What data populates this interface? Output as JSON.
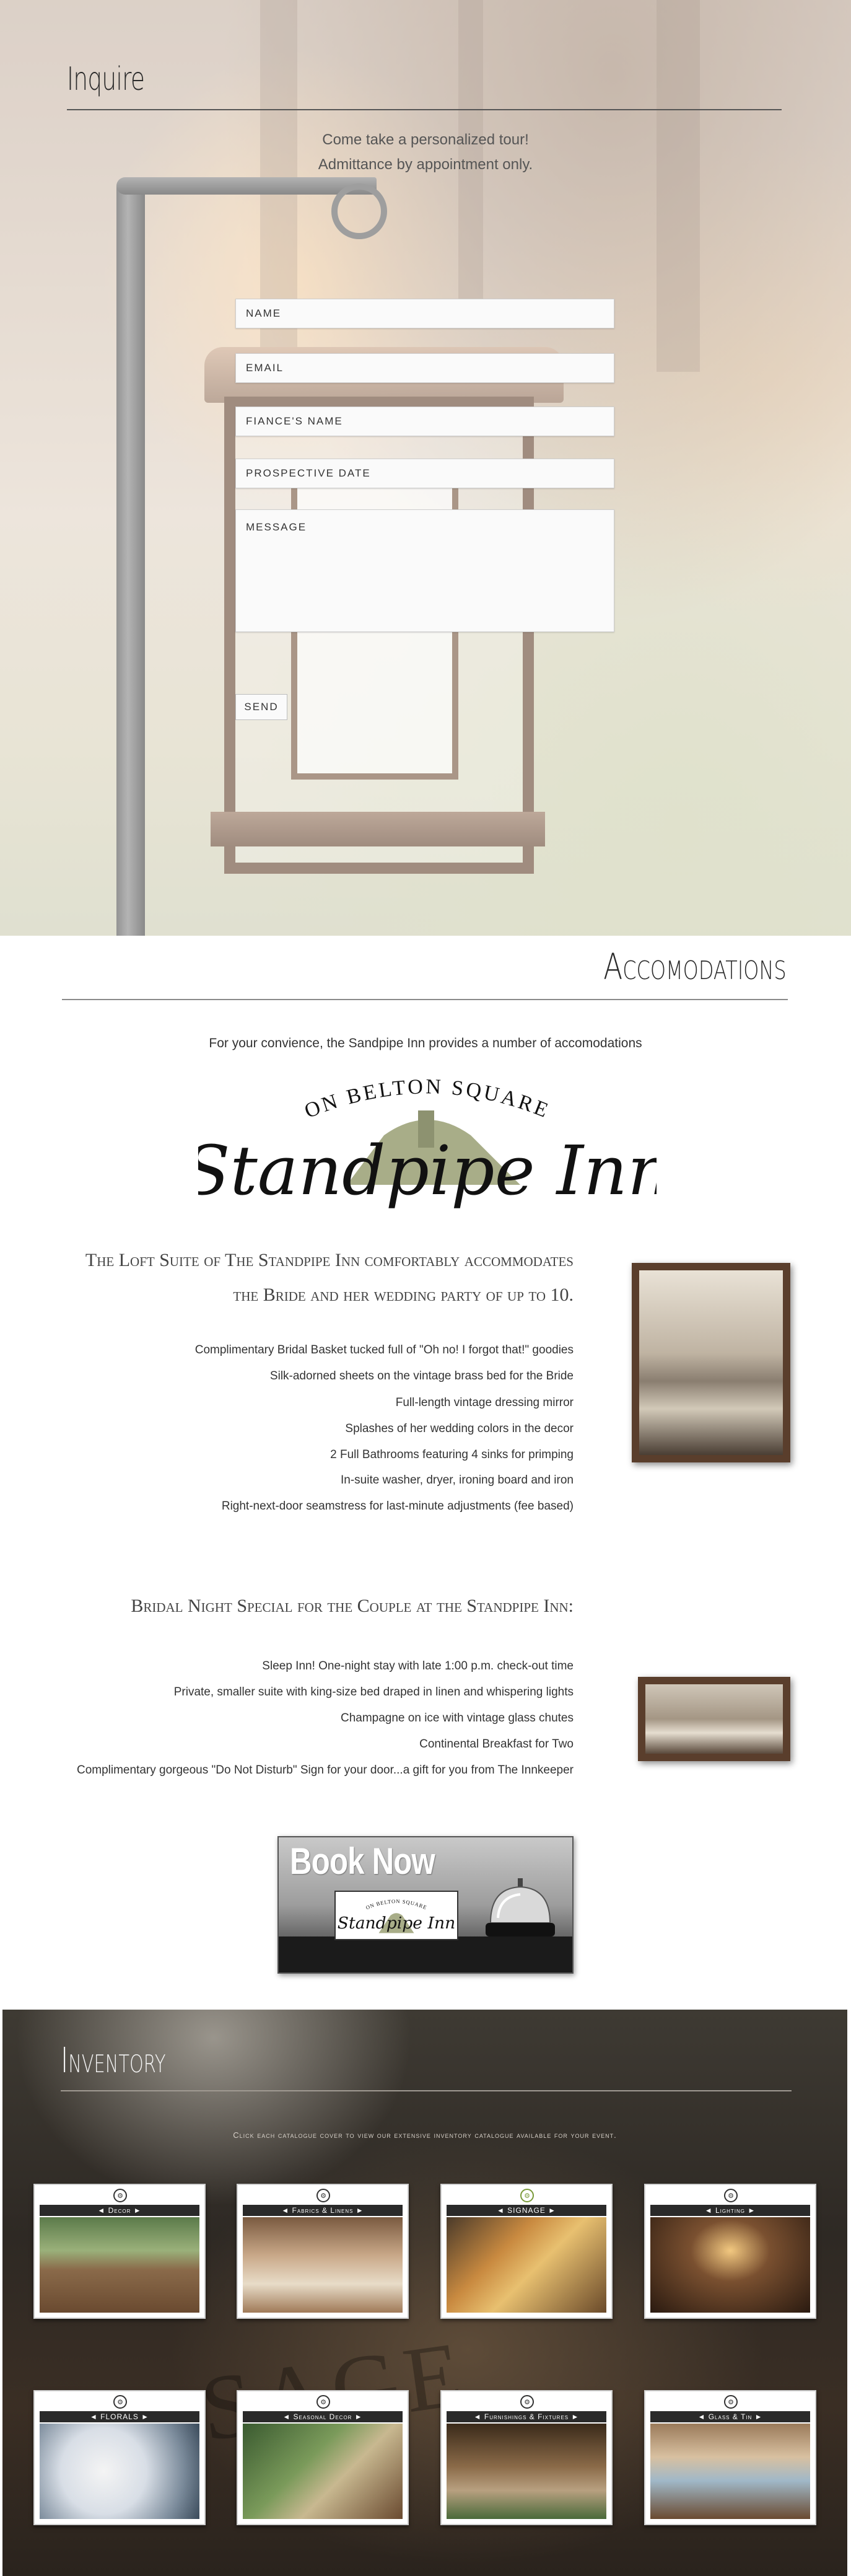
{
  "inquire": {
    "title": "Inquire",
    "subtitle_1": "Come take a personalized tour!",
    "subtitle_2": "Admittance by appointment only.",
    "fields": {
      "name": "NAME",
      "email": "EMAIL",
      "fiance": "FIANCE'S NAME",
      "date": "PROSPECTIVE DATE",
      "message": "MESSAGE"
    },
    "send_label": "SEND"
  },
  "accommodations": {
    "title": "Accomodations",
    "intro": "For your convience, the Sandpipe Inn provides a number of accomodations",
    "logo": {
      "arc_text": "ON BELTON SQUARE",
      "name": "Standpipe Inn"
    },
    "loft": {
      "title_1": "The Loft Suite of The Standpipe Inn comfortably accommodates",
      "title_2": "the Bride and her wedding party of up to 10.",
      "items": [
        "Complimentary Bridal Basket tucked full of \"Oh no! I forgot that!\" goodies",
        "Silk-adorned sheets on the vintage brass bed for the Bride",
        "Full-length vintage dressing mirror",
        "Splashes of her wedding colors in the decor",
        "2 Full Bathrooms featuring 4 sinks for primping",
        "In-suite washer, dryer, ironing board and iron",
        "Right-next-door seamstress for last-minute adjustments (fee based)"
      ]
    },
    "bridal_night": {
      "title": "Bridal Night Special for the Couple at the Standpipe Inn:",
      "items": [
        "Sleep Inn! One-night stay with late 1:00 p.m. check-out time",
        "Private, smaller suite with king-size bed draped in linen and whispering lights",
        "Champagne on ice with vintage glass chutes",
        "Continental Breakfast for Two",
        "Complimentary gorgeous \"Do Not Disturb\" Sign for your door...a gift for you from The Innkeeper"
      ]
    },
    "book_now": {
      "label": "Book Now",
      "card_arc": "ON BELTON SQUARE",
      "card_name": "Standpipe Inn"
    }
  },
  "inventory": {
    "title": "Inventory",
    "subtitle": "Click each catalogue cover to view our extensive inventory catalogue available for your event.",
    "catalogues": [
      {
        "label": "◄ Decor ►",
        "icon": "gear-icon"
      },
      {
        "label": "◄ Fabrics & Linens ►",
        "icon": "gear-icon"
      },
      {
        "label": "◄ SIGNAGE ►",
        "icon": "gear-icon"
      },
      {
        "label": "◄ Lighting ►",
        "icon": "gear-icon"
      },
      {
        "label": "◄ FLORALS ►",
        "icon": "gear-icon"
      },
      {
        "label": "◄ Seasonal Decor ►",
        "icon": "gear-icon"
      },
      {
        "label": "◄ Furnishings & Fixtures ►",
        "icon": "gear-icon"
      },
      {
        "label": "◄ Glass & Tin ►",
        "icon": "gear-icon"
      }
    ]
  },
  "colors": {
    "accent_dark": "#2a2a2a",
    "frame_brown": "#5a3e2c",
    "logo_sage": "#a8ad88"
  }
}
